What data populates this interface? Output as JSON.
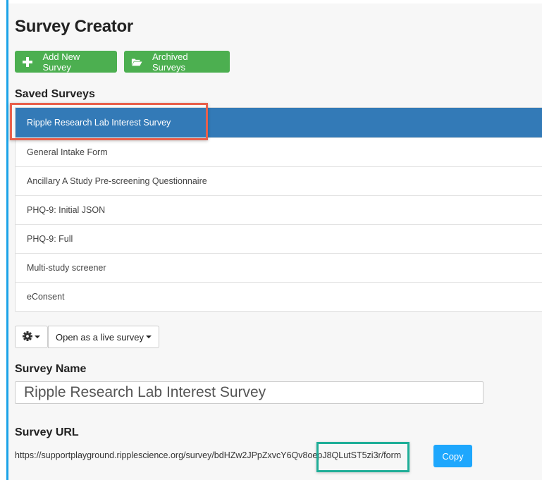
{
  "page": {
    "title": "Survey Creator"
  },
  "toolbar": {
    "add_label": "Add New Survey",
    "add_icon": "plus-icon",
    "archived_label": "Archived Surveys",
    "archived_icon": "folder-open-icon"
  },
  "saved_surveys": {
    "heading": "Saved Surveys",
    "selected_index": 0,
    "items": [
      {
        "label": "Ripple Research Lab Interest Survey"
      },
      {
        "label": "General Intake Form"
      },
      {
        "label": "Ancillary A Study Pre-screening Questionnaire"
      },
      {
        "label": "PHQ-9: Initial JSON"
      },
      {
        "label": "PHQ-9: Full"
      },
      {
        "label": "Multi-study screener"
      },
      {
        "label": "eConsent"
      }
    ]
  },
  "actions": {
    "settings_icon": "gear-icon",
    "open_label": "Open as a live survey"
  },
  "survey_name": {
    "heading": "Survey Name",
    "value": "Ripple Research Lab Interest Survey"
  },
  "survey_url": {
    "heading": "Survey URL",
    "url": "https://supportplayground.ripplescience.org/survey/bdHZw2JPpZxvcY6Qv8oepJ8QLutST5zi3r/form",
    "copy_label": "Copy"
  },
  "colors": {
    "accent_left": "#1aa3e8",
    "primary_selected": "#337ab7",
    "success": "#4caf50",
    "copy_button": "#1ea7fd",
    "highlight_red": "#e8604c",
    "highlight_teal": "#1fae98"
  }
}
